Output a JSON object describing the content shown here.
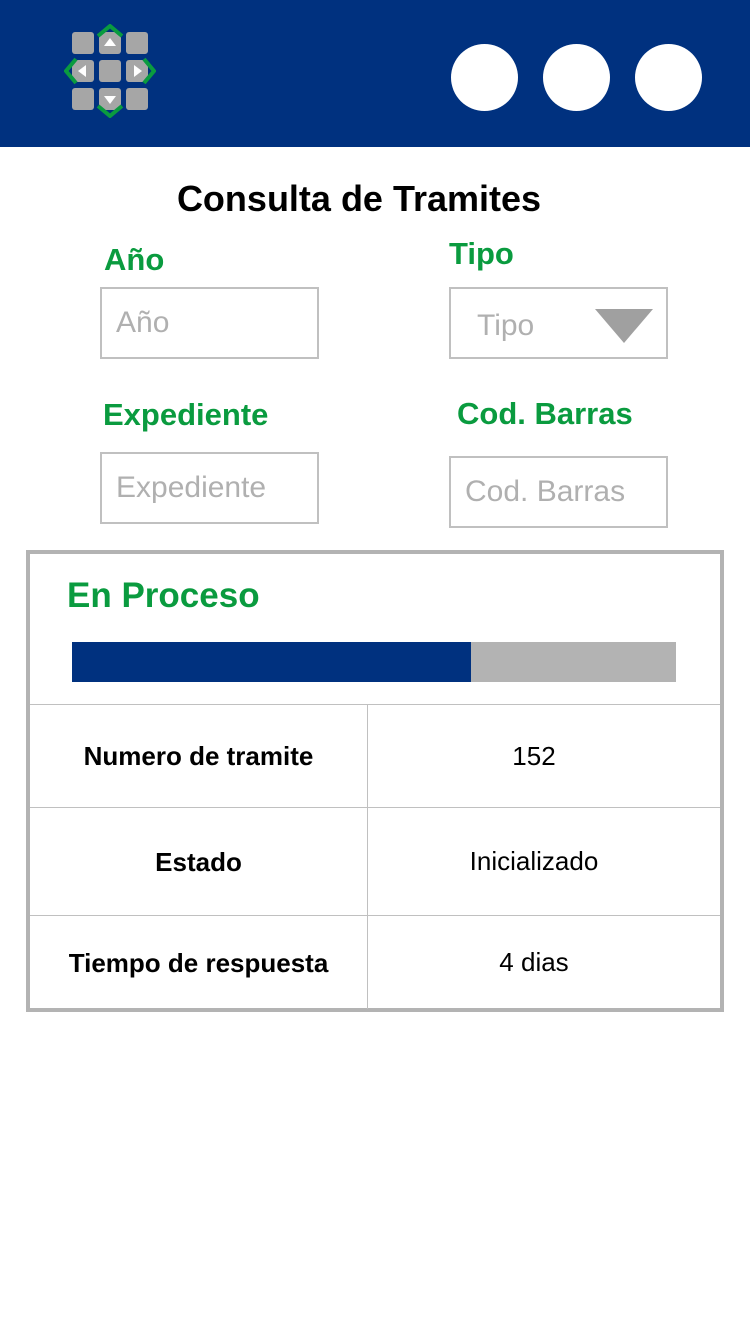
{
  "header": {
    "logo_icon": "app-logo-icon",
    "buttons": [
      "circle-button",
      "circle-button",
      "circle-button"
    ],
    "brand_color": "#00317f",
    "accent_color": "#0a9b3f"
  },
  "page": {
    "title": "Consulta de Tramites"
  },
  "form": {
    "anio": {
      "label": "Año",
      "placeholder": "Año"
    },
    "tipo": {
      "label": "Tipo",
      "placeholder": "Tipo"
    },
    "expediente": {
      "label": "Expediente",
      "placeholder": "Expediente"
    },
    "cod_barras": {
      "label": "Cod. Barras",
      "placeholder": "Cod. Barras"
    }
  },
  "status": {
    "title": "En Proceso",
    "progress_fraction": 0.66
  },
  "details": [
    {
      "label": "Numero de tramite",
      "value": "152"
    },
    {
      "label": "Estado",
      "value": "Inicializado"
    },
    {
      "label": "Tiempo de respuesta",
      "value": "4 dias"
    }
  ]
}
